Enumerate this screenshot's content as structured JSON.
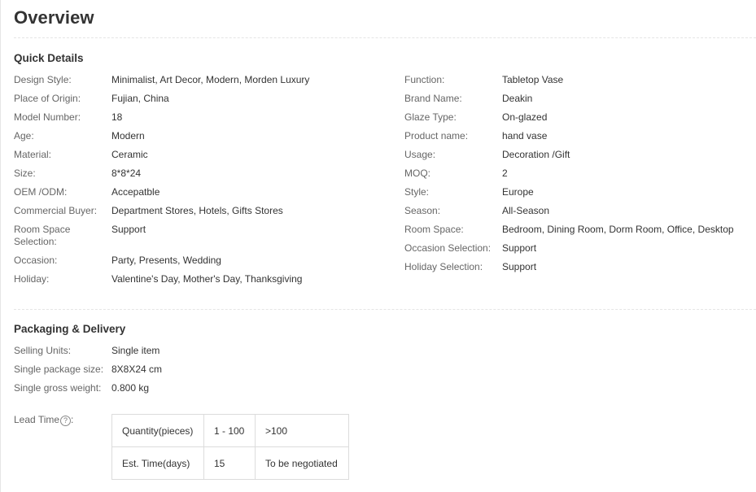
{
  "page_title": "Overview",
  "quick_details": {
    "heading": "Quick Details",
    "left": [
      {
        "label": "Design Style:",
        "value": "Minimalist, Art Decor, Modern, Morden Luxury"
      },
      {
        "label": "Place of Origin:",
        "value": "Fujian, China"
      },
      {
        "label": "Model Number:",
        "value": "18"
      },
      {
        "label": "Age:",
        "value": "Modern"
      },
      {
        "label": "Material:",
        "value": "Ceramic"
      },
      {
        "label": "Size:",
        "value": "8*8*24"
      },
      {
        "label": "OEM /ODM:",
        "value": "Accepatble"
      },
      {
        "label": "Commercial Buyer:",
        "value": "Department Stores, Hotels, Gifts Stores"
      },
      {
        "label": "Room Space Selection:",
        "value": "Support"
      },
      {
        "label": "Occasion:",
        "value": "Party, Presents, Wedding"
      },
      {
        "label": "Holiday:",
        "value": "Valentine's Day, Mother's Day, Thanksgiving"
      }
    ],
    "right": [
      {
        "label": "Function:",
        "value": "Tabletop Vase"
      },
      {
        "label": "Brand Name:",
        "value": "Deakin"
      },
      {
        "label": "Glaze Type:",
        "value": "On-glazed"
      },
      {
        "label": "Product name:",
        "value": "hand vase"
      },
      {
        "label": "Usage:",
        "value": "Decoration /Gift"
      },
      {
        "label": "MOQ:",
        "value": "2"
      },
      {
        "label": "Style:",
        "value": "Europe"
      },
      {
        "label": "Season:",
        "value": "All-Season"
      },
      {
        "label": "Room Space:",
        "value": "Bedroom, Dining Room, Dorm Room, Office, Desktop"
      },
      {
        "label": "Occasion Selection:",
        "value": "Support"
      },
      {
        "label": "Holiday Selection:",
        "value": "Support"
      }
    ]
  },
  "packaging": {
    "heading": "Packaging & Delivery",
    "rows": [
      {
        "label": "Selling Units:",
        "value": "Single item"
      },
      {
        "label": "Single package size:",
        "value": "8X8X24 cm"
      },
      {
        "label": "Single gross weight:",
        "value": "0.800 kg"
      }
    ],
    "lead_time": {
      "label": "Lead Time",
      "help_icon": "question-circle-icon",
      "help_glyph": "?",
      "table": [
        [
          "Quantity(pieces)",
          "1 - 100",
          ">100"
        ],
        [
          "Est. Time(days)",
          "15",
          "To be negotiated"
        ]
      ]
    }
  }
}
